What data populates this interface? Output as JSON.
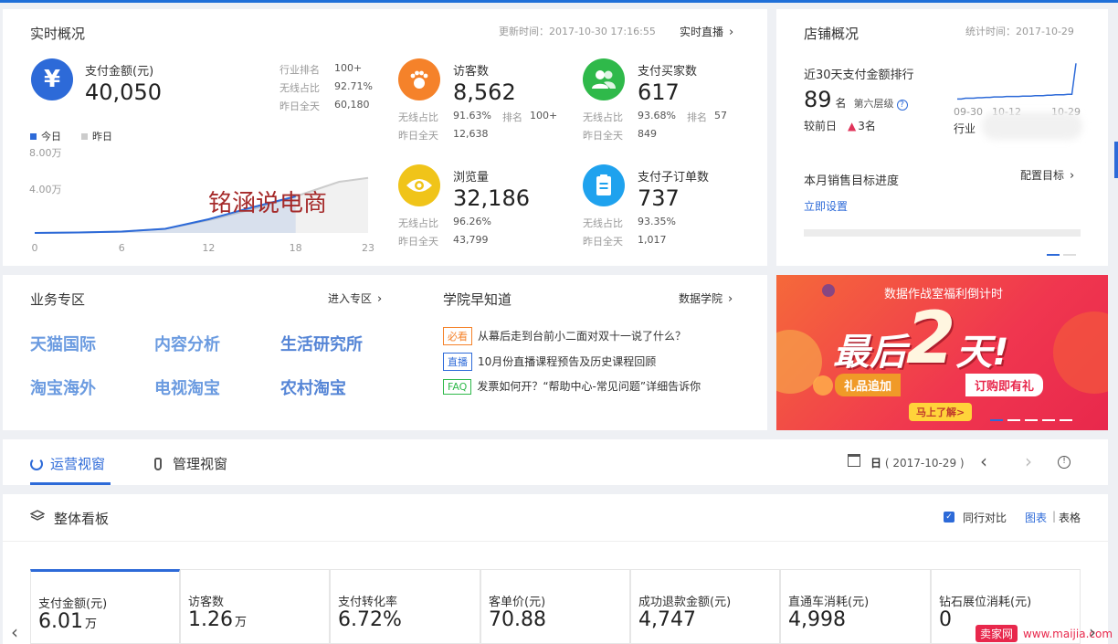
{
  "realtime": {
    "title": "实时概况",
    "update_time": "更新时间：2017-10-30 17:16:55",
    "live_link": "实时直播",
    "pay": {
      "label": "支付金额(元)",
      "value": "40,050",
      "rank_label": "行业排名",
      "rank_value": "100+",
      "wireless_label": "无线占比",
      "wireless_value": "92.71%",
      "yesterday_label": "昨日全天",
      "yesterday_value": "60,180"
    },
    "legend_today": "今日",
    "legend_yesterday": "昨日",
    "chart_data": {
      "type": "area",
      "x": [
        0,
        3,
        6,
        9,
        12,
        15,
        18,
        21,
        23
      ],
      "x_ticks": [
        "0",
        "6",
        "12",
        "18",
        "23"
      ],
      "y_ticks": [
        "4.00万",
        "8.00万"
      ],
      "ylim": [
        0,
        80000
      ],
      "series": [
        {
          "name": "今日",
          "values": [
            0,
            500,
            1500,
            4500,
            15000,
            28000,
            40050,
            null,
            null
          ]
        },
        {
          "name": "昨日",
          "values": [
            0,
            500,
            1500,
            4500,
            14000,
            26000,
            40000,
            56000,
            60180
          ]
        }
      ],
      "colors": {
        "today": "#2d6ad8",
        "yesterday": "#cccccc"
      }
    },
    "watermark": "铭涵说电商",
    "visitors": {
      "label": "访客数",
      "value": "8,562",
      "l1": "无线占比",
      "v1": "91.63%",
      "l2": "排名",
      "v2": "100+",
      "l3": "昨日全天",
      "v3": "12,638",
      "color": "#f5822a"
    },
    "buyers": {
      "label": "支付买家数",
      "value": "617",
      "l1": "无线占比",
      "v1": "93.68%",
      "l2": "排名",
      "v2": "57",
      "l3": "昨日全天",
      "v3": "849",
      "color": "#2fb94a"
    },
    "pageviews": {
      "label": "浏览量",
      "value": "32,186",
      "l1": "无线占比",
      "v1": "96.26%",
      "l3": "昨日全天",
      "v3": "43,799",
      "color": "#f0c419"
    },
    "suborders": {
      "label": "支付子订单数",
      "value": "737",
      "l1": "无线占比",
      "v1": "93.35%",
      "l3": "昨日全天",
      "v3": "1,017",
      "color": "#1fa2ee"
    }
  },
  "shop": {
    "title": "店铺概况",
    "stat_time": "统计时间：2017-10-29",
    "rank_title": "近30天支付金额排行",
    "rank_num": "89",
    "rank_unit": "名",
    "level": "第六层级",
    "compare_label": "较前日",
    "compare_value": "3名",
    "x_ticks": [
      "09-30",
      "10-12",
      "10-29"
    ],
    "industry_label": "行业",
    "trend_data": [
      0.1,
      0.1,
      0.12,
      0.12,
      0.12,
      0.13,
      0.13,
      0.14,
      0.14,
      0.15,
      0.15,
      0.15,
      0.16,
      0.16,
      0.16,
      0.16,
      0.17,
      0.17,
      0.17,
      0.18,
      0.18,
      0.18,
      0.19,
      0.19,
      0.2,
      0.2,
      0.2,
      0.21,
      0.21,
      0.95
    ],
    "goal_title": "本月销售目标进度",
    "goal_link": "配置目标",
    "goal_setup": "立即设置"
  },
  "business": {
    "title": "业务专区",
    "enter_link": "进入专区",
    "items": [
      "天猫国际",
      "内容分析",
      "生活研究所",
      "淘宝海外",
      "电视淘宝",
      "农村淘宝"
    ]
  },
  "academy": {
    "title": "学院早知道",
    "link": "数据学院",
    "news": [
      {
        "tag": "必看",
        "text": "从幕后走到台前小二面对双十一说了什么？",
        "tag_color": "#f5822a"
      },
      {
        "tag": "直播",
        "text": "10月份直播课程预告及历史课程回顾",
        "tag_color": "#2d6ad8"
      },
      {
        "tag": "FAQ",
        "text": "发票如何开？“帮助中心-常见问题”详细告诉你",
        "tag_color": "#2fb94a"
      }
    ]
  },
  "banner": {
    "top_text": "数据作战室福利倒计时",
    "big_text_1": "最后",
    "big_text_2": "2",
    "big_text_3": "天!",
    "left_badge": "礼品追加",
    "right_badge": "订购即有礼",
    "button": "马上了解>"
  },
  "tabs": {
    "operation": "运营视窗",
    "management": "管理视窗",
    "date_unit": "日",
    "date_value": "( 2017-10-29 )"
  },
  "dashboard": {
    "title": "整体看板",
    "compare_label": "同行对比",
    "view_chart": "图表",
    "view_table": "表格",
    "kpis": [
      {
        "label": "支付金额(元)",
        "value": "6.01",
        "unit": "万"
      },
      {
        "label": "访客数",
        "value": "1.26",
        "unit": "万"
      },
      {
        "label": "支付转化率",
        "value": "6.72%",
        "unit": ""
      },
      {
        "label": "客单价(元)",
        "value": "70.88",
        "unit": ""
      },
      {
        "label": "成功退款金额(元)",
        "value": "4,747",
        "unit": ""
      },
      {
        "label": "直通车消耗(元)",
        "value": "4,998",
        "unit": ""
      },
      {
        "label": "钻石展位消耗(元)",
        "value": "0",
        "unit": ""
      }
    ]
  },
  "footer_watermark": {
    "brand": "卖家网",
    "url": "www.maijia.com"
  }
}
